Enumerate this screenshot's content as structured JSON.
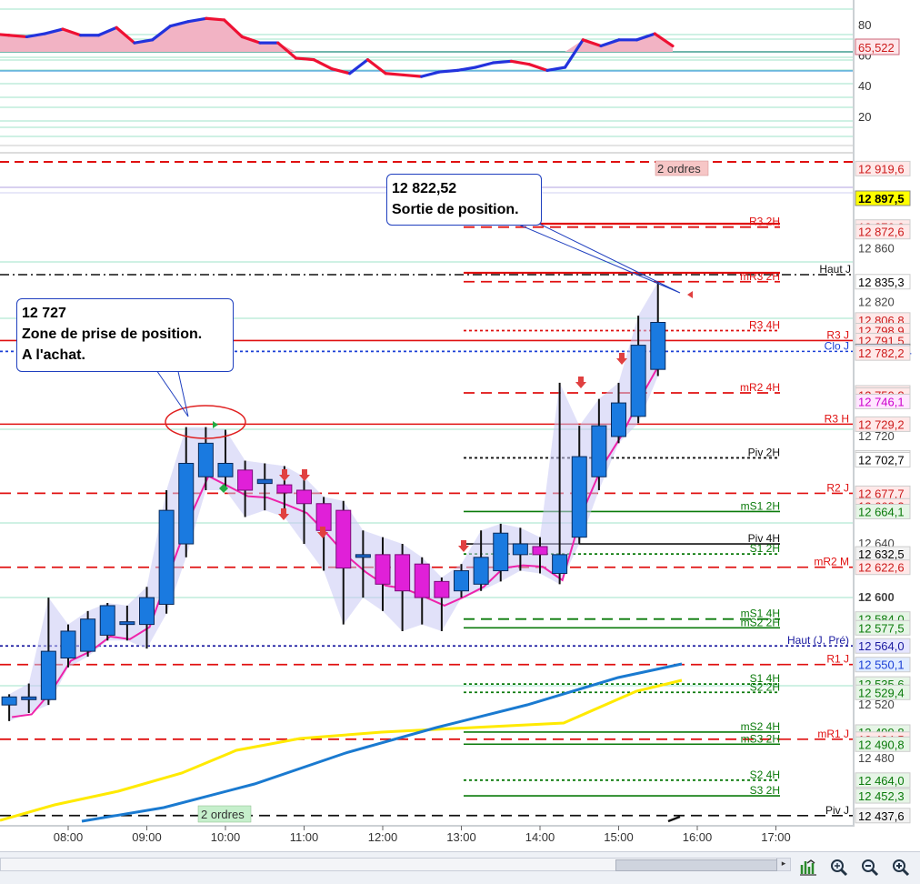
{
  "chart_data": {
    "type": "candlestick",
    "price_axis": {
      "min": 12430,
      "max": 12930,
      "ticks": [
        12860,
        12820,
        12720,
        12640,
        12600,
        12520,
        12480
      ]
    },
    "time_axis": {
      "labels": [
        "08:00",
        "09:00",
        "10:00",
        "11:00",
        "12:00",
        "13:00",
        "14:00",
        "15:00",
        "16:00",
        "17:00"
      ]
    },
    "candles": [
      {
        "t": 7.25,
        "o": 12520,
        "h": 12528,
        "l": 12508,
        "c": 12526,
        "dir": "up"
      },
      {
        "t": 7.5,
        "o": 12526,
        "h": 12536,
        "l": 12514,
        "c": 12524,
        "dir": "doji"
      },
      {
        "t": 7.75,
        "o": 12524,
        "h": 12600,
        "l": 12520,
        "c": 12560,
        "dir": "up"
      },
      {
        "t": 8.0,
        "o": 12555,
        "h": 12580,
        "l": 12548,
        "c": 12575,
        "dir": "up"
      },
      {
        "t": 8.25,
        "o": 12560,
        "h": 12590,
        "l": 12556,
        "c": 12584,
        "dir": "up"
      },
      {
        "t": 8.5,
        "o": 12572,
        "h": 12596,
        "l": 12568,
        "c": 12594,
        "dir": "up"
      },
      {
        "t": 8.75,
        "o": 12582,
        "h": 12594,
        "l": 12568,
        "c": 12580,
        "dir": "doji"
      },
      {
        "t": 9.0,
        "o": 12580,
        "h": 12608,
        "l": 12562,
        "c": 12600,
        "dir": "up"
      },
      {
        "t": 9.25,
        "o": 12595,
        "h": 12680,
        "l": 12588,
        "c": 12665,
        "dir": "up"
      },
      {
        "t": 9.5,
        "o": 12640,
        "h": 12727,
        "l": 12630,
        "c": 12700,
        "dir": "up"
      },
      {
        "t": 9.75,
        "o": 12690,
        "h": 12727,
        "l": 12680,
        "c": 12715,
        "dir": "up"
      },
      {
        "t": 10.0,
        "o": 12700,
        "h": 12725,
        "l": 12680,
        "c": 12690,
        "dir": "up"
      },
      {
        "t": 10.25,
        "o": 12695,
        "h": 12702,
        "l": 12660,
        "c": 12680,
        "dir": "down"
      },
      {
        "t": 10.5,
        "o": 12685,
        "h": 12700,
        "l": 12665,
        "c": 12688,
        "dir": "doji"
      },
      {
        "t": 10.75,
        "o": 12684,
        "h": 12698,
        "l": 12660,
        "c": 12678,
        "dir": "down"
      },
      {
        "t": 11.0,
        "o": 12680,
        "h": 12690,
        "l": 12640,
        "c": 12670,
        "dir": "down"
      },
      {
        "t": 11.25,
        "o": 12670,
        "h": 12675,
        "l": 12620,
        "c": 12650,
        "dir": "down"
      },
      {
        "t": 11.5,
        "o": 12665,
        "h": 12672,
        "l": 12580,
        "c": 12622,
        "dir": "down"
      },
      {
        "t": 11.75,
        "o": 12630,
        "h": 12650,
        "l": 12600,
        "c": 12632,
        "dir": "doji"
      },
      {
        "t": 12.0,
        "o": 12632,
        "h": 12645,
        "l": 12590,
        "c": 12610,
        "dir": "down"
      },
      {
        "t": 12.25,
        "o": 12632,
        "h": 12640,
        "l": 12575,
        "c": 12605,
        "dir": "down"
      },
      {
        "t": 12.5,
        "o": 12625,
        "h": 12630,
        "l": 12580,
        "c": 12600,
        "dir": "down"
      },
      {
        "t": 12.75,
        "o": 12612,
        "h": 12615,
        "l": 12575,
        "c": 12600,
        "dir": "down"
      },
      {
        "t": 13.0,
        "o": 12605,
        "h": 12625,
        "l": 12600,
        "c": 12620,
        "dir": "up"
      },
      {
        "t": 13.25,
        "o": 12610,
        "h": 12650,
        "l": 12605,
        "c": 12630,
        "dir": "up"
      },
      {
        "t": 13.5,
        "o": 12620,
        "h": 12655,
        "l": 12612,
        "c": 12648,
        "dir": "up"
      },
      {
        "t": 13.75,
        "o": 12632,
        "h": 12652,
        "l": 12620,
        "c": 12640,
        "dir": "up"
      },
      {
        "t": 14.0,
        "o": 12638,
        "h": 12645,
        "l": 12618,
        "c": 12632,
        "dir": "down"
      },
      {
        "t": 14.25,
        "o": 12618,
        "h": 12760,
        "l": 12610,
        "c": 12632,
        "dir": "up"
      },
      {
        "t": 14.5,
        "o": 12645,
        "h": 12728,
        "l": 12640,
        "c": 12705,
        "dir": "up"
      },
      {
        "t": 14.75,
        "o": 12690,
        "h": 12748,
        "l": 12680,
        "c": 12728,
        "dir": "up"
      },
      {
        "t": 15.0,
        "o": 12720,
        "h": 12760,
        "l": 12715,
        "c": 12745,
        "dir": "up"
      },
      {
        "t": 15.25,
        "o": 12735,
        "h": 12810,
        "l": 12730,
        "c": 12788,
        "dir": "up"
      },
      {
        "t": 15.5,
        "o": 12770,
        "h": 12835,
        "l": 12765,
        "c": 12805,
        "dir": "up"
      }
    ],
    "price_labels": [
      {
        "text": "12 919,6",
        "value": 12919.6,
        "color": "#cc1a1a",
        "bg": "#ffe8e8",
        "highlight": false
      },
      {
        "text": "12 897,5",
        "value": 12897.5,
        "color": "#000000",
        "bg": "#ffff00",
        "highlight": true
      },
      {
        "text": "12 876,0",
        "value": 12876.0,
        "color": "#cc1a1a",
        "bg": "#ffe8e8",
        "highlight": false
      },
      {
        "text": "12 872,6",
        "value": 12872.6,
        "color": "#cc1a1a",
        "bg": "#ffe8e8",
        "highlight": false
      },
      {
        "text": "12 835,3",
        "value": 12835.3,
        "color": "#000000",
        "bg": "#ffffff",
        "highlight": false
      },
      {
        "text": "12 806,8",
        "value": 12806.8,
        "color": "#cc1a1a",
        "bg": "#ffe8e8",
        "highlight": false
      },
      {
        "text": "12 798,9",
        "value": 12798.9,
        "color": "#cc1a1a",
        "bg": "#ffe8e8",
        "highlight": false
      },
      {
        "text": "12 791,5",
        "value": 12791.5,
        "color": "#cc1a1a",
        "bg": "#ffe8e8",
        "highlight": false
      },
      {
        "text": "12 783,4",
        "value": 12783.4,
        "color": "#1a3fd6",
        "bg": "#dbe4ff",
        "highlight": true
      },
      {
        "text": "12 782,2",
        "value": 12782.2,
        "color": "#cc1a1a",
        "bg": "#ffe8e8",
        "highlight": false
      },
      {
        "text": "12 752,5",
        "value": 12752.5,
        "color": "#cc1a1a",
        "bg": "#ffe8e8",
        "highlight": false
      },
      {
        "text": "12 750,8",
        "value": 12750.8,
        "color": "#cc1a1a",
        "bg": "#ffe8e8",
        "highlight": false
      },
      {
        "text": "12 746,1",
        "value": 12746.1,
        "color": "#cc00cc",
        "bg": "#ffe6ff",
        "highlight": false
      },
      {
        "text": "12 729,2",
        "value": 12729.2,
        "color": "#cc1a1a",
        "bg": "#ffe8e8",
        "highlight": false
      },
      {
        "text": "12 704,1",
        "value": 12704.1,
        "color": "#000000",
        "bg": "#f2f2f2",
        "highlight": false
      },
      {
        "text": "12 702,7",
        "value": 12702.7,
        "color": "#000000",
        "bg": "#ffffff",
        "highlight": false
      },
      {
        "text": "12 677,7",
        "value": 12677.7,
        "color": "#cc1a1a",
        "bg": "#ffe8e8",
        "highlight": false
      },
      {
        "text": "12 668,3",
        "value": 12668.3,
        "color": "#cc1a1a",
        "bg": "#ffe8e8",
        "highlight": false
      },
      {
        "text": "12 664,1",
        "value": 12664.1,
        "color": "#0a7a0a",
        "bg": "#e6f5e6",
        "highlight": false
      },
      {
        "text": "12 632,5",
        "value": 12632.5,
        "color": "#000000",
        "bg": "#f2f2f2",
        "highlight": false
      },
      {
        "text": "12 622,6",
        "value": 12622.6,
        "color": "#cc1a1a",
        "bg": "#ffe8e8",
        "highlight": false
      },
      {
        "text": "12 584,0",
        "value": 12584.0,
        "color": "#0a7a0a",
        "bg": "#e6f5e6",
        "highlight": false
      },
      {
        "text": "12 577,5",
        "value": 12577.5,
        "color": "#0a7a0a",
        "bg": "#e6f5e6",
        "highlight": false
      },
      {
        "text": "12 564,0",
        "value": 12564.0,
        "color": "#1a1aa0",
        "bg": "#e6e6ff",
        "highlight": false
      },
      {
        "text": "12 550,1",
        "value": 12550.1,
        "color": "#1a3fd6",
        "bg": "#e0ecff",
        "highlight": false
      },
      {
        "text": "12 535,6",
        "value": 12535.6,
        "color": "#0a7a0a",
        "bg": "#e6f5e6",
        "highlight": false
      },
      {
        "text": "12 529,4",
        "value": 12529.4,
        "color": "#0a7a0a",
        "bg": "#e6f5e6",
        "highlight": false
      },
      {
        "text": "12 499,8",
        "value": 12499.8,
        "color": "#0a7a0a",
        "bg": "#e6f5e6",
        "highlight": false
      },
      {
        "text": "12 494,5",
        "value": 12494.5,
        "color": "#cc1a1a",
        "bg": "#ffe8e8",
        "highlight": false
      },
      {
        "text": "12 490,8",
        "value": 12490.8,
        "color": "#0a7a0a",
        "bg": "#e6f5e6",
        "highlight": false
      },
      {
        "text": "12 464,0",
        "value": 12464.0,
        "color": "#0a7a0a",
        "bg": "#e6f5e6",
        "highlight": false
      },
      {
        "text": "12 452,3",
        "value": 12452.3,
        "color": "#0a7a0a",
        "bg": "#e6f5e6",
        "highlight": false
      },
      {
        "text": "12 437,6",
        "value": 12437.6,
        "color": "#000000",
        "bg": "#f2f2f2",
        "highlight": false
      }
    ],
    "levels": [
      {
        "label": "R3 2H",
        "value": 12876.0,
        "color": "#e01010",
        "style": "dashed",
        "range": "right"
      },
      {
        "label": "mR3 2H",
        "value": 12835.3,
        "color": "#e01010",
        "style": "dashed",
        "range": "right"
      },
      {
        "label": "R3 4H",
        "value": 12798.9,
        "color": "#e01010",
        "style": "dotted",
        "range": "right"
      },
      {
        "label": "R3 J",
        "value": 12791.5,
        "color": "#e01010",
        "style": "solid",
        "range": "full"
      },
      {
        "label": "Clo J",
        "value": 12783.4,
        "color": "#1a3fd6",
        "style": "dotted",
        "range": "full"
      },
      {
        "label": "mR2 4H",
        "value": 12752.5,
        "color": "#e01010",
        "style": "dashed",
        "range": "right"
      },
      {
        "label": "R3 H",
        "value": 12729.2,
        "color": "#e01010",
        "style": "solid",
        "range": "full"
      },
      {
        "label": "Piv 2H",
        "value": 12704.1,
        "color": "#111111",
        "style": "dotted",
        "range": "right"
      },
      {
        "label": "R2 J",
        "value": 12677.7,
        "color": "#e01010",
        "style": "dashed",
        "range": "full"
      },
      {
        "label": "mS1 2H",
        "value": 12664.1,
        "color": "#0a7a0a",
        "style": "solid",
        "range": "right"
      },
      {
        "label": "Piv 4H",
        "value": 12640.0,
        "color": "#111111",
        "style": "solid",
        "range": "right"
      },
      {
        "label": "S1 2H",
        "value": 12632.5,
        "color": "#0a7a0a",
        "style": "dotted",
        "range": "right"
      },
      {
        "label": "mR2 M",
        "value": 12622.6,
        "color": "#e01010",
        "style": "dashed",
        "range": "full"
      },
      {
        "label": "mS1 4H",
        "value": 12584.0,
        "color": "#0a7a0a",
        "style": "dashed",
        "range": "right"
      },
      {
        "label": "mS2 2H",
        "value": 12577.5,
        "color": "#0a7a0a",
        "style": "solid",
        "range": "right"
      },
      {
        "label": "Haut (J, Pré)",
        "value": 12564.0,
        "color": "#1a1aa0",
        "style": "dotted",
        "range": "full"
      },
      {
        "label": "R1 J",
        "value": 12550.1,
        "color": "#e01010",
        "style": "dashed",
        "range": "full"
      },
      {
        "label": "S1 4H",
        "value": 12535.6,
        "color": "#0a7a0a",
        "style": "dotted",
        "range": "right"
      },
      {
        "label": "S2 2H",
        "value": 12529.4,
        "color": "#0a7a0a",
        "style": "dotted",
        "range": "right"
      },
      {
        "label": "mS2 4H",
        "value": 12499.8,
        "color": "#0a7a0a",
        "style": "solid",
        "range": "right"
      },
      {
        "label": "mR1 J",
        "value": 12494.5,
        "color": "#e01010",
        "style": "dashed",
        "range": "full"
      },
      {
        "label": "mS3 2H",
        "value": 12490.8,
        "color": "#0a7a0a",
        "style": "solid",
        "range": "right"
      },
      {
        "label": "S2 4H",
        "value": 12464.0,
        "color": "#0a7a0a",
        "style": "dotted",
        "range": "right"
      },
      {
        "label": "S3 2H",
        "value": 12452.3,
        "color": "#0a7a0a",
        "style": "solid",
        "range": "right"
      },
      {
        "label": "Piv J",
        "value": 12437.6,
        "color": "#111111",
        "style": "dashed",
        "range": "full"
      }
    ],
    "rsi": {
      "value_label": "65,522",
      "ticks": [
        80,
        60,
        40,
        20
      ],
      "values": [
        74,
        73,
        72,
        74,
        77,
        73,
        73,
        78,
        68,
        70,
        79,
        82,
        84,
        83,
        72,
        68,
        68,
        58,
        57,
        51,
        48,
        57,
        48,
        47,
        46,
        49,
        50,
        52,
        55,
        56,
        54,
        50,
        52,
        70,
        66,
        70,
        70,
        74,
        66
      ]
    },
    "orders_labels": [
      "2 ordres",
      "2 ordres"
    ],
    "haut_label": "Haut J"
  },
  "annotations": {
    "entry": {
      "line1": "12 727",
      "line2": "Zone de prise de position.",
      "line3": "A l'achat."
    },
    "exit": {
      "line1": "12 822,52",
      "line2": "Sortie de position."
    }
  },
  "toolbar": {
    "icons": [
      "scroll-right-icon",
      "bar-chart-icon",
      "zoom-fit-icon",
      "zoom-out-icon",
      "zoom-in-icon"
    ]
  }
}
